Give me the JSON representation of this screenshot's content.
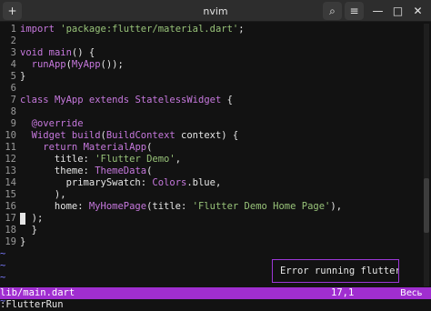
{
  "window": {
    "title": "nvim",
    "new_tab_icon": "+",
    "search_icon": "⌕",
    "menu_icon": "≡",
    "minimize_icon": "—",
    "maximize_icon": "□",
    "close_icon": "✕"
  },
  "editor": {
    "lines": [
      {
        "n": "1",
        "segments": [
          {
            "c": "k",
            "t": "import"
          },
          {
            "c": "p",
            "t": " "
          },
          {
            "c": "s",
            "t": "'package:flutter/material.dart'"
          },
          {
            "c": "p",
            "t": ";"
          }
        ]
      },
      {
        "n": "2",
        "segments": []
      },
      {
        "n": "3",
        "segments": [
          {
            "c": "k",
            "t": "void"
          },
          {
            "c": "p",
            "t": " "
          },
          {
            "c": "f",
            "t": "main"
          },
          {
            "c": "p",
            "t": "() {"
          }
        ]
      },
      {
        "n": "4",
        "segments": [
          {
            "c": "p",
            "t": "  "
          },
          {
            "c": "f",
            "t": "runApp"
          },
          {
            "c": "p",
            "t": "("
          },
          {
            "c": "t",
            "t": "MyApp"
          },
          {
            "c": "p",
            "t": "());"
          }
        ]
      },
      {
        "n": "5",
        "segments": [
          {
            "c": "p",
            "t": "}"
          }
        ]
      },
      {
        "n": "6",
        "segments": []
      },
      {
        "n": "7",
        "segments": [
          {
            "c": "k",
            "t": "class"
          },
          {
            "c": "p",
            "t": " "
          },
          {
            "c": "t",
            "t": "MyApp"
          },
          {
            "c": "p",
            "t": " "
          },
          {
            "c": "k",
            "t": "extends"
          },
          {
            "c": "p",
            "t": " "
          },
          {
            "c": "t",
            "t": "StatelessWidget"
          },
          {
            "c": "p",
            "t": " {"
          }
        ]
      },
      {
        "n": "8",
        "segments": []
      },
      {
        "n": "9",
        "segments": [
          {
            "c": "p",
            "t": "  "
          },
          {
            "c": "at",
            "t": "@override"
          }
        ]
      },
      {
        "n": "10",
        "segments": [
          {
            "c": "p",
            "t": "  "
          },
          {
            "c": "t",
            "t": "Widget"
          },
          {
            "c": "p",
            "t": " "
          },
          {
            "c": "f",
            "t": "build"
          },
          {
            "c": "p",
            "t": "("
          },
          {
            "c": "t",
            "t": "BuildContext"
          },
          {
            "c": "p",
            "t": " context) {"
          }
        ]
      },
      {
        "n": "11",
        "segments": [
          {
            "c": "p",
            "t": "    "
          },
          {
            "c": "k",
            "t": "return"
          },
          {
            "c": "p",
            "t": " "
          },
          {
            "c": "t",
            "t": "MaterialApp"
          },
          {
            "c": "p",
            "t": "("
          }
        ]
      },
      {
        "n": "12",
        "segments": [
          {
            "c": "p",
            "t": "      title: "
          },
          {
            "c": "s",
            "t": "'Flutter Demo'"
          },
          {
            "c": "p",
            "t": ","
          }
        ]
      },
      {
        "n": "13",
        "segments": [
          {
            "c": "p",
            "t": "      theme: "
          },
          {
            "c": "t",
            "t": "ThemeData"
          },
          {
            "c": "p",
            "t": "("
          }
        ]
      },
      {
        "n": "14",
        "segments": [
          {
            "c": "p",
            "t": "        primarySwatch: "
          },
          {
            "c": "t",
            "t": "Colors"
          },
          {
            "c": "p",
            "t": ".blue,"
          }
        ]
      },
      {
        "n": "15",
        "segments": [
          {
            "c": "p",
            "t": "      ),"
          }
        ]
      },
      {
        "n": "16",
        "segments": [
          {
            "c": "p",
            "t": "      home: "
          },
          {
            "c": "t",
            "t": "MyHomePage"
          },
          {
            "c": "p",
            "t": "(title: "
          },
          {
            "c": "s",
            "t": "'Flutter Demo Home Page'"
          },
          {
            "c": "p",
            "t": "),"
          }
        ]
      },
      {
        "n": "17",
        "segments": [
          {
            "c": "p",
            "t": "  );"
          }
        ],
        "cursor": true
      },
      {
        "n": "18",
        "segments": [
          {
            "c": "p",
            "t": "  }"
          }
        ]
      },
      {
        "n": "19",
        "segments": [
          {
            "c": "p",
            "t": "}"
          }
        ]
      }
    ],
    "tilde": "~",
    "tilde_count": 5
  },
  "error_popup": {
    "text": "Error running flutter s"
  },
  "statusline": {
    "file": "lib/main.dart",
    "position": "17,1",
    "scroll": "Весь"
  },
  "cmdline": {
    "text": ":FlutterRun"
  },
  "colors": {
    "background": "#121212",
    "keyword": "#c678dd",
    "string": "#98c379",
    "statusline": "#a02ed0",
    "popup_border": "#9d37d8",
    "tilde": "#7a7aff"
  }
}
